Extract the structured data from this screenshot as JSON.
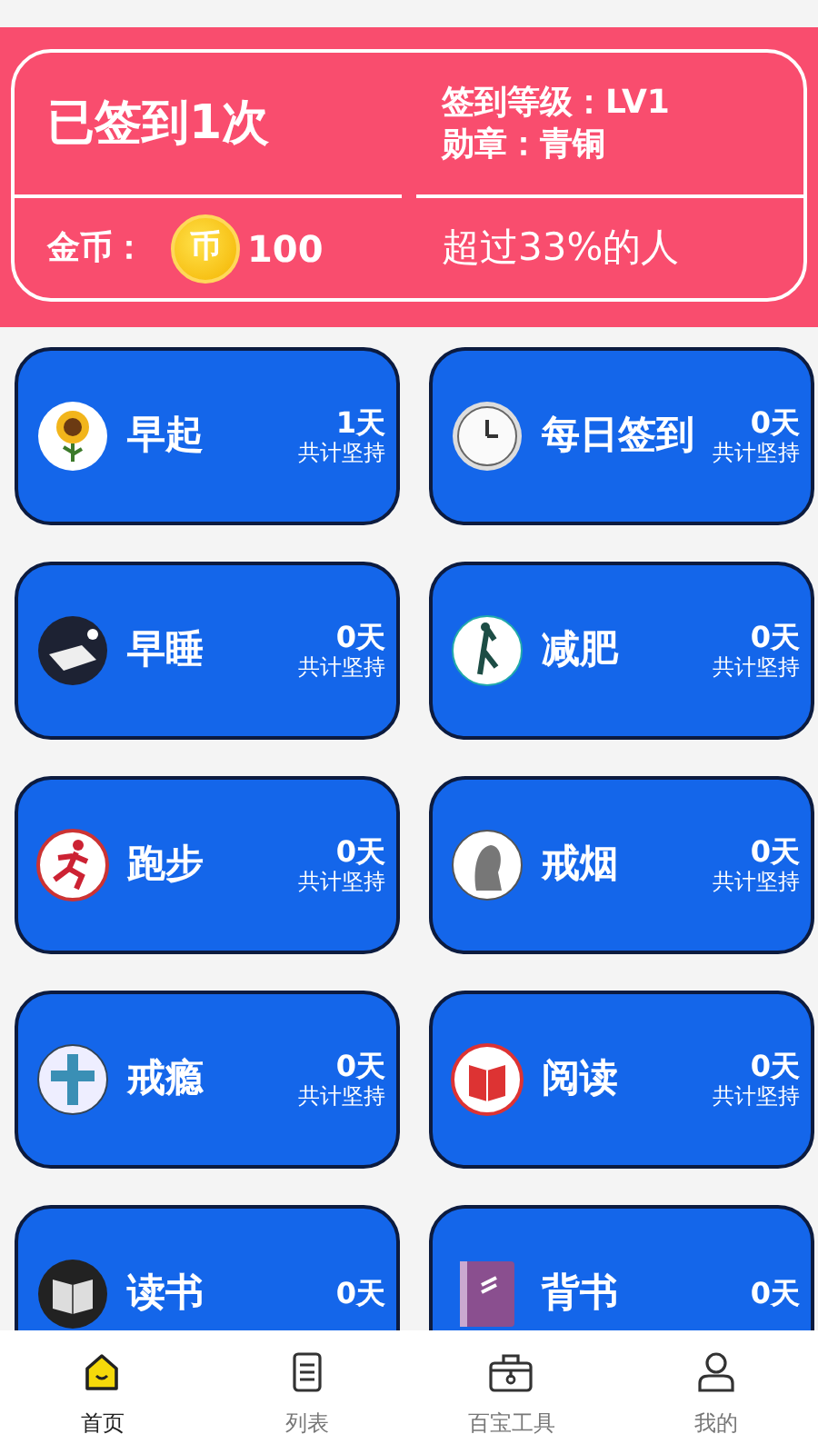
{
  "summary": {
    "checkins": "已签到1次",
    "level": "签到等级：LV1",
    "medal": "勋章：青铜",
    "coins_label": "金币：",
    "coin_glyph": "币",
    "coins": "100",
    "rank": "超过33%的人"
  },
  "habits": [
    {
      "title": "早起",
      "days": "1天",
      "caption": "共计坚持"
    },
    {
      "title": "每日签到",
      "days": "0天",
      "caption": "共计坚持"
    },
    {
      "title": "早睡",
      "days": "0天",
      "caption": "共计坚持"
    },
    {
      "title": "减肥",
      "days": "0天",
      "caption": "共计坚持"
    },
    {
      "title": "跑步",
      "days": "0天",
      "caption": "共计坚持"
    },
    {
      "title": "戒烟",
      "days": "0天",
      "caption": "共计坚持"
    },
    {
      "title": "戒瘾",
      "days": "0天",
      "caption": "共计坚持"
    },
    {
      "title": "阅读",
      "days": "0天",
      "caption": "共计坚持"
    },
    {
      "title": "读书",
      "days": "0天"
    },
    {
      "title": "背书",
      "days": "0天"
    }
  ],
  "tabs": [
    {
      "label": "首页",
      "selected": true
    },
    {
      "label": "列表",
      "selected": false
    },
    {
      "label": "百宝工具",
      "selected": false
    },
    {
      "label": "我的",
      "selected": false
    }
  ]
}
